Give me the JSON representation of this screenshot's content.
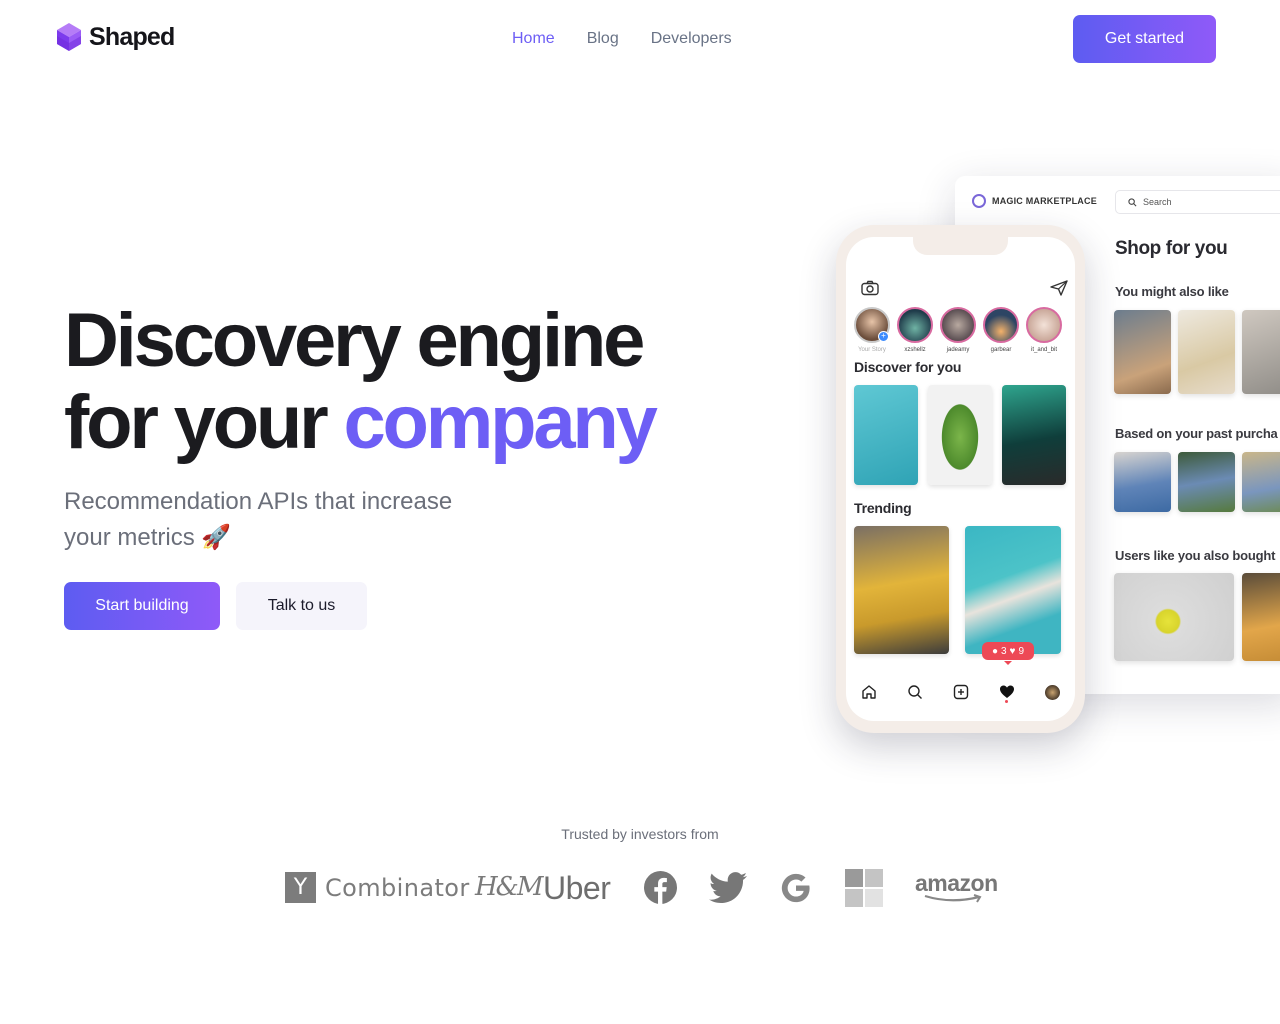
{
  "header": {
    "brand": "Shaped",
    "nav": [
      "Home",
      "Blog",
      "Developers"
    ],
    "active_nav": "Home",
    "cta": "Get started"
  },
  "hero": {
    "headline_line1": "Discovery engine",
    "headline_line2_plain": "for your ",
    "headline_line2_accent": "company",
    "subhead": "Recommendation APIs that increase your metrics 🚀",
    "primary_button": "Start building",
    "secondary_button": "Talk to us"
  },
  "desktop_mockup": {
    "brand": "MAGIC MARKETPLACE",
    "search_placeholder": "Search",
    "title": "Shop for you",
    "sections": [
      "You might also like",
      "Based on your past purcha",
      "Users like you also bought"
    ]
  },
  "phone_mockup": {
    "stories": [
      "Your Story",
      "xzshellz",
      "jadeamy",
      "garbear",
      "it_and_bit"
    ],
    "section_discover": "Discover for you",
    "section_trending": "Trending",
    "notification": {
      "comments": "3",
      "likes": "9"
    }
  },
  "trusted": {
    "label": "Trusted by investors from",
    "logos": {
      "yc_letter": "Y",
      "yc_word": "Combinator",
      "hm": "H&M",
      "uber": "Uber",
      "amazon": "amazon"
    }
  },
  "colors": {
    "accent": "#6d5ef5",
    "gradient_start": "#5d5cf1",
    "gradient_end": "#8f5af8",
    "nav_text": "#697386",
    "instagram_red": "#ed4956"
  }
}
